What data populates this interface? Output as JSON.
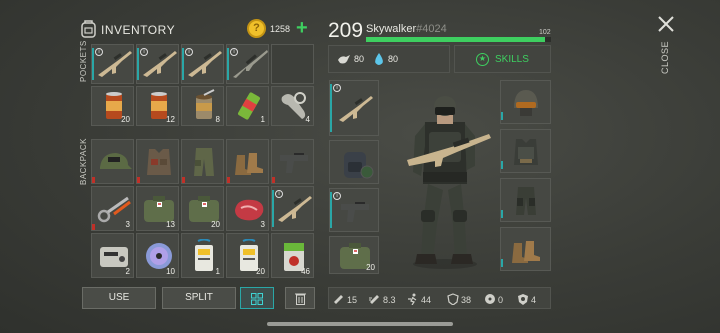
{
  "inventory": {
    "title": "INVENTORY",
    "coins": "1258",
    "add_label": "+"
  },
  "sections": {
    "pockets": "POCKETS",
    "backpack": "BACKPACK"
  },
  "pockets": [
    {
      "name": "assault-rifle"
    },
    {
      "name": "assault-rifle"
    },
    {
      "name": "assault-rifle"
    },
    {
      "name": "sniper-rifle"
    },
    {
      "name": "empty"
    },
    {
      "name": "canned-food",
      "qty": "20"
    },
    {
      "name": "canned-food",
      "qty": "12"
    },
    {
      "name": "open-can",
      "qty": "8"
    },
    {
      "name": "energy-drink",
      "qty": "1"
    },
    {
      "name": "mechanical-parts",
      "qty": "4"
    }
  ],
  "backpack": [
    {
      "name": "cap"
    },
    {
      "name": "tactical-vest"
    },
    {
      "name": "cargo-pants"
    },
    {
      "name": "boots"
    },
    {
      "name": "pistol"
    },
    {
      "name": "scissors",
      "qty": "3"
    },
    {
      "name": "medkit",
      "qty": "13"
    },
    {
      "name": "medkit",
      "qty": "20"
    },
    {
      "name": "meat",
      "qty": "3"
    },
    {
      "name": "assault-rifle"
    },
    {
      "name": "radio",
      "qty": "2"
    },
    {
      "name": "disc",
      "qty": "10"
    },
    {
      "name": "keycard",
      "qty": "1"
    },
    {
      "name": "keycard",
      "qty": "20"
    },
    {
      "name": "hazard-card",
      "qty": "46"
    }
  ],
  "actions": {
    "use": "USE",
    "split": "SPLIT"
  },
  "player": {
    "level": "209",
    "name": "Skywalker",
    "tag": "#4024",
    "xp_label": "102",
    "xp_fraction": 0.97
  },
  "vitals": {
    "food": "80",
    "water": "80"
  },
  "skills_label": "SKILLS",
  "weapon_slots": [
    {
      "name": "assault-rifle"
    },
    {
      "name": "backpack"
    },
    {
      "name": "pistol"
    },
    {
      "name": "medkit",
      "qty": "20"
    }
  ],
  "gear_slots": [
    {
      "name": "helmet"
    },
    {
      "name": "vest"
    },
    {
      "name": "pants"
    },
    {
      "name": "boots"
    }
  ],
  "stats": [
    {
      "icon": "attack-icon",
      "value": "15"
    },
    {
      "icon": "speed-icon",
      "value": "8.3"
    },
    {
      "icon": "move-speed-icon",
      "value": "44"
    },
    {
      "icon": "armor-icon",
      "value": "38"
    },
    {
      "icon": "radiation-icon",
      "value": "0"
    },
    {
      "icon": "defense-icon",
      "value": "4"
    }
  ],
  "close_label": "CLOSE",
  "colors": {
    "accent": "#3ecf60",
    "teal": "#2aa7a7",
    "coin": "#f0c02a"
  }
}
